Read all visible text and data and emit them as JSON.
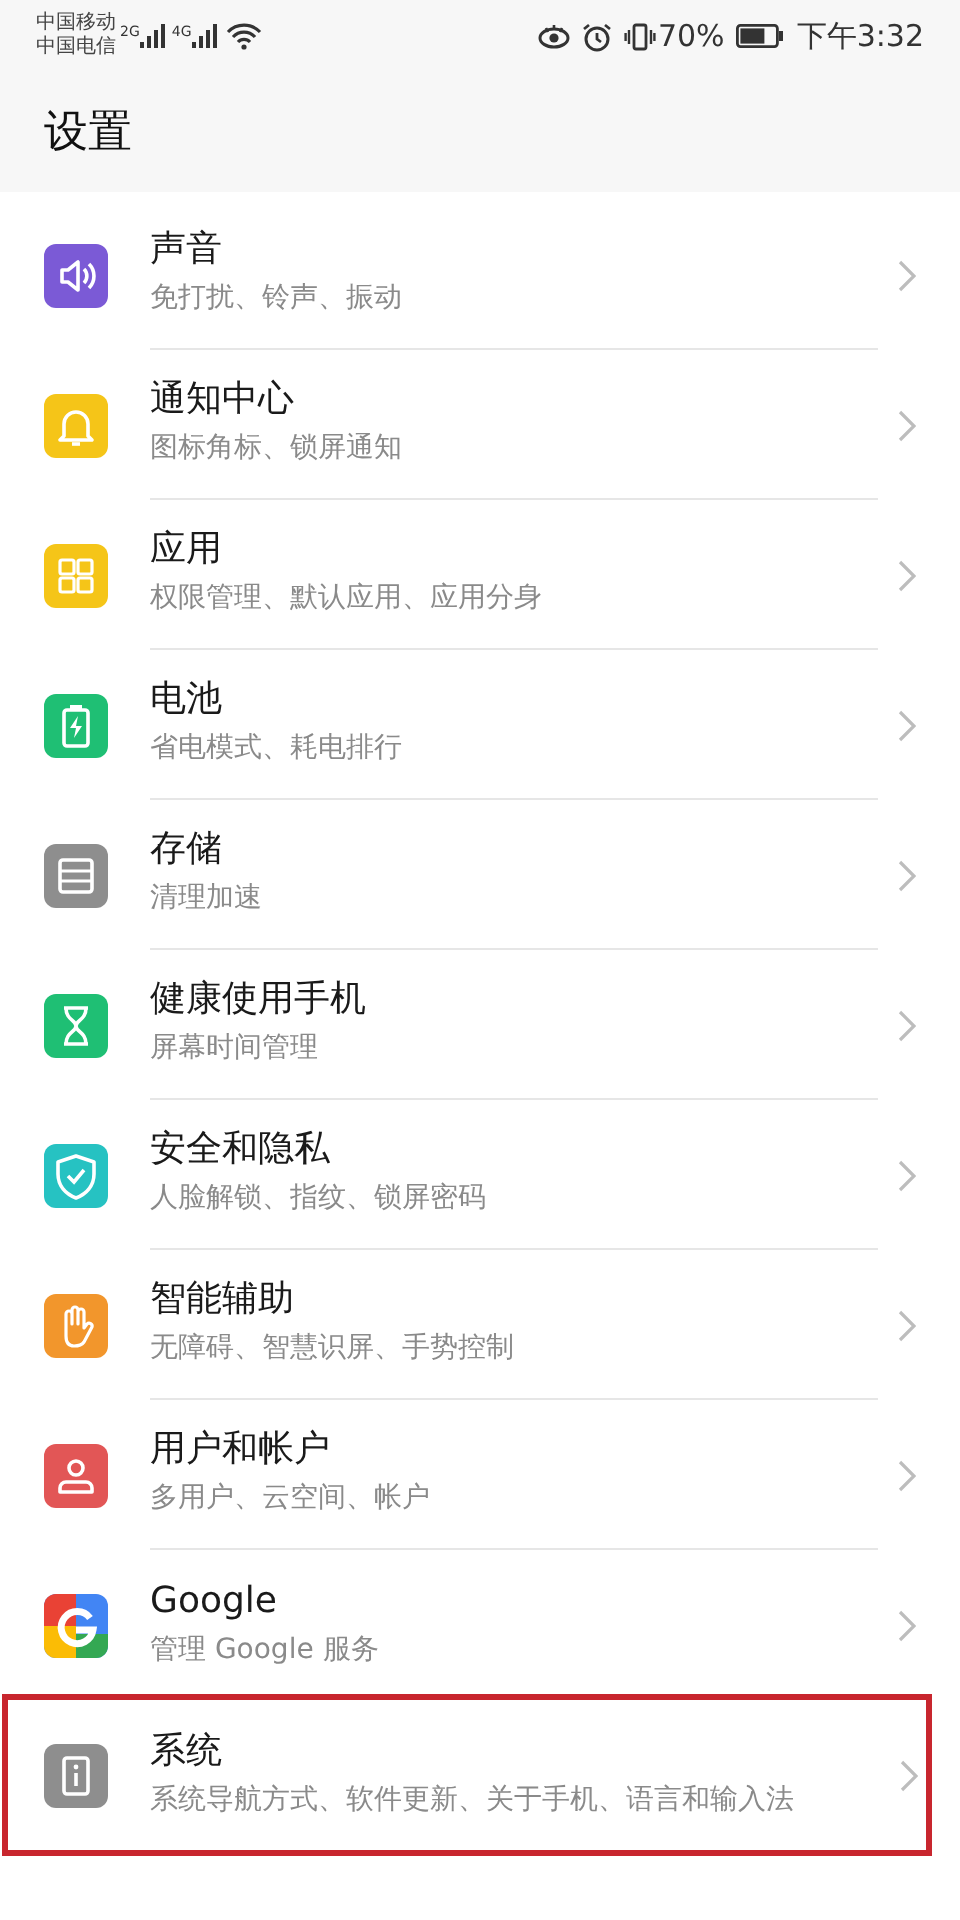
{
  "status_bar": {
    "carriers": [
      "中国移动",
      "中国电信"
    ],
    "networks": [
      "2G",
      "4G"
    ],
    "battery_percent": "70%",
    "time": "下午3:32"
  },
  "title": "设置",
  "items": [
    {
      "title": "声音",
      "subtitle": "免打扰、铃声、振动",
      "kind": "sound",
      "color": "#7b5ad6",
      "highlighted": false
    },
    {
      "title": "通知中心",
      "subtitle": "图标角标、锁屏通知",
      "kind": "bell",
      "color": "#f5c518",
      "highlighted": false
    },
    {
      "title": "应用",
      "subtitle": "权限管理、默认应用、应用分身",
      "kind": "apps",
      "color": "#f5c518",
      "highlighted": false
    },
    {
      "title": "电池",
      "subtitle": "省电模式、耗电排行",
      "kind": "battery",
      "color": "#1fbf74",
      "highlighted": false
    },
    {
      "title": "存储",
      "subtitle": "清理加速",
      "kind": "storage",
      "color": "#8e8e8e",
      "highlighted": false
    },
    {
      "title": "健康使用手机",
      "subtitle": "屏幕时间管理",
      "kind": "hourglass",
      "color": "#1fbf74",
      "highlighted": false
    },
    {
      "title": "安全和隐私",
      "subtitle": "人脸解锁、指纹、锁屏密码",
      "kind": "shield",
      "color": "#26c2c2",
      "highlighted": false
    },
    {
      "title": "智能辅助",
      "subtitle": "无障碍、智慧识屏、手势控制",
      "kind": "hand",
      "color": "#f2962c",
      "highlighted": false
    },
    {
      "title": "用户和帐户",
      "subtitle": "多用户、云空间、帐户",
      "kind": "user",
      "color": "#e25656",
      "highlighted": false
    },
    {
      "title": "Google",
      "subtitle": "管理 Google 服务",
      "kind": "google",
      "color": "#4285f4",
      "highlighted": false
    },
    {
      "title": "系统",
      "subtitle": "系统导航方式、软件更新、关于手机、语言和输入法",
      "kind": "info",
      "color": "#8e8e8e",
      "highlighted": true
    }
  ]
}
